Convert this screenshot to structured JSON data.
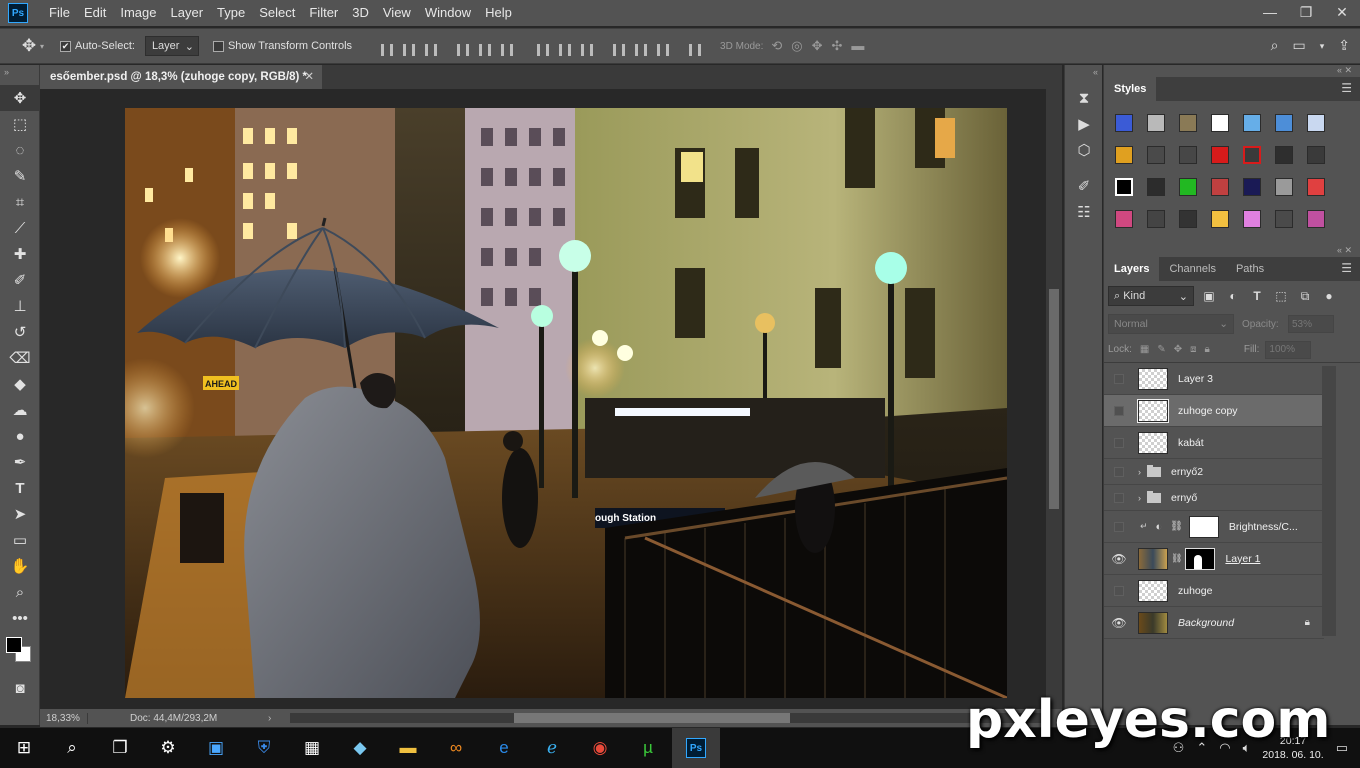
{
  "menubar": {
    "logo": "Ps",
    "items": [
      "File",
      "Edit",
      "Image",
      "Layer",
      "Type",
      "Select",
      "Filter",
      "3D",
      "View",
      "Window",
      "Help"
    ]
  },
  "options_bar": {
    "auto_select_label": "Auto-Select:",
    "auto_select_value": "Layer",
    "transform_label": "Show Transform Controls",
    "mode_3d_label": "3D Mode:"
  },
  "document": {
    "tab_title": "esőember.psd @ 18,3% (zuhoge copy, RGB/8) *",
    "zoom": "18,33%",
    "doc_info": "Doc: 44,4M/293,2M",
    "canvas_texts": {
      "street_sign": "AHEAD",
      "station_sign": "ough   Station"
    }
  },
  "styles_panel": {
    "tab": "Styles",
    "swatches": [
      "#3b5bd6",
      "#b9b9b9",
      "#8a7a56",
      "#ffffff",
      "#66aee8",
      "#4d8ed8",
      "#c9d8f0",
      "#e0a020",
      "#4a4a4a",
      "#474747",
      "#d81b1b",
      "#5a4a4a",
      "#2e2e2e",
      "#3a3a3a",
      "#000000",
      "#2c2c2c",
      "#22b822",
      "#c04040",
      "#1a1a55",
      "#9a9a9a",
      "#e04040",
      "#d04880",
      "#444444",
      "#333333",
      "#f2c040",
      "#e080e0",
      "#4a4a4a",
      "#c050a0"
    ]
  },
  "layers_panel": {
    "tabs": [
      "Layers",
      "Channels",
      "Paths"
    ],
    "kind_label": "Kind",
    "blend_mode": "Normal",
    "opacity_label": "Opacity:",
    "opacity_value": "53%",
    "lock_label": "Lock:",
    "fill_label": "Fill:",
    "fill_value": "100%",
    "layers": [
      {
        "name": "Layer 3",
        "type": "pixel",
        "visible": false
      },
      {
        "name": "zuhoge copy",
        "type": "pixel",
        "visible": false,
        "selected": true
      },
      {
        "name": "kabát",
        "type": "pixel",
        "visible": false
      },
      {
        "name": "ernyő2",
        "type": "group",
        "visible": false
      },
      {
        "name": "ernyő",
        "type": "group",
        "visible": false
      },
      {
        "name": "Brightness/C...",
        "type": "adjustment",
        "visible": false
      },
      {
        "name": "Layer 1",
        "type": "masked",
        "visible": true
      },
      {
        "name": "zuhoge",
        "type": "pixel",
        "visible": false
      },
      {
        "name": "Background",
        "type": "background",
        "visible": true,
        "locked": true
      }
    ]
  },
  "taskbar": {
    "clock_time": "20:17",
    "clock_date": "2018. 06. 10."
  },
  "watermark": "pxleyes.com"
}
